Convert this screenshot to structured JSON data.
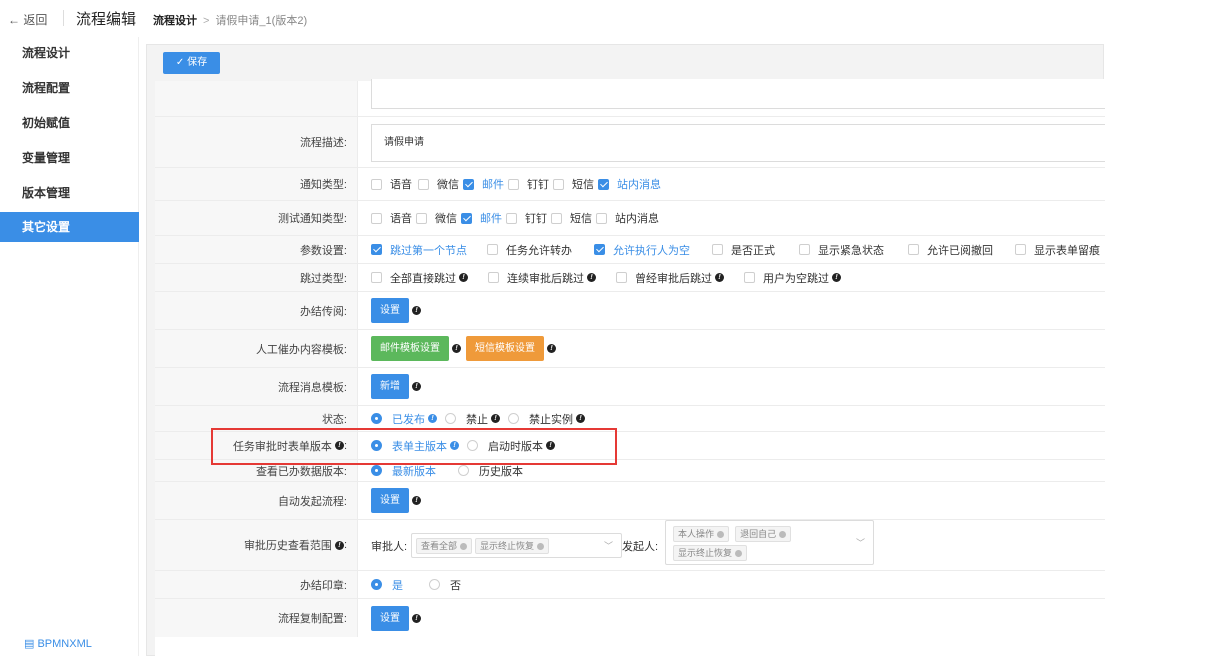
{
  "header": {
    "back": "← 返回",
    "title": "流程编辑",
    "breadcrumb_current": "流程设计",
    "breadcrumb_sep": ">",
    "breadcrumb_doc": "请假申请_1(版本2)"
  },
  "sidebar": {
    "items": [
      "流程设计",
      "流程配置",
      "初始赋值",
      "变量管理",
      "版本管理",
      "其它设置"
    ],
    "active": "其它设置",
    "footer": "BPMNXML"
  },
  "toolbar": {
    "save": "✓ 保存"
  },
  "form": {
    "desc_label": "流程描述:",
    "desc_value": "请假申请",
    "notify_label": "通知类型:",
    "notify_options": [
      {
        "label": "语音",
        "checked": false
      },
      {
        "label": "微信",
        "checked": true
      },
      {
        "label": "邮件",
        "checked": false
      },
      {
        "label": "钉钉",
        "checked": false
      },
      {
        "label": "短信",
        "checked": true
      },
      {
        "label": "站内消息",
        "checked": false
      }
    ],
    "test_notify_label": "测试通知类型:",
    "test_notify_options": [
      {
        "label": "语音",
        "checked": false
      },
      {
        "label": "微信",
        "checked": true
      },
      {
        "label": "邮件",
        "checked": false
      },
      {
        "label": "钉钉",
        "checked": false
      },
      {
        "label": "短信",
        "checked": false
      },
      {
        "label": "站内消息",
        "checked": false
      }
    ],
    "param_label": "参数设置:",
    "param_options": [
      {
        "label": "跳过第一个节点",
        "checked": true
      },
      {
        "label": "任务允许转办",
        "checked": false
      },
      {
        "label": "允许执行人为空",
        "checked": true
      },
      {
        "label": "是否正式",
        "checked": false
      },
      {
        "label": "显示紧急状态",
        "checked": false
      },
      {
        "label": "允许已阅撤回",
        "checked": false
      },
      {
        "label": "显示表单留痕",
        "checked": false
      }
    ],
    "skip_label": "跳过类型:",
    "skip_options": [
      "全部直接跳过",
      "连续审批后跳过",
      "曾经审批后跳过",
      "用户为空跳过"
    ],
    "circulate_label": "办结传阅:",
    "set_btn": "设置",
    "remind_label": "人工催办内容模板:",
    "email_tpl_btn": "邮件模板设置",
    "sms_tpl_btn": "短信模板设置",
    "msg_tpl_label": "流程消息模板:",
    "add_btn": "新增",
    "status_label": "状态:",
    "status_options": [
      {
        "label": "已发布",
        "checked": true
      },
      {
        "label": "禁止",
        "checked": false
      },
      {
        "label": "禁止实例",
        "checked": false
      }
    ],
    "form_ver_label": "任务审批时表单版本",
    "form_ver_options": [
      {
        "label": "表单主版本",
        "checked": true
      },
      {
        "label": "启动时版本",
        "checked": false
      }
    ],
    "view_ver_label": "查看已办数据版本:",
    "view_ver_options": [
      {
        "label": "最新版本",
        "checked": true
      },
      {
        "label": "历史版本",
        "checked": false
      }
    ],
    "auto_label": "自动发起流程:",
    "history_label": "审批历史查看范围",
    "approver_label": "审批人:",
    "approver_tags": [
      "查看全部",
      "显示终止恢复"
    ],
    "initiator_label": "发起人:",
    "initiator_tags": [
      "本人操作",
      "退回自己",
      "显示终止恢复"
    ],
    "seal_label": "办结印章:",
    "seal_options": [
      {
        "label": "是",
        "checked": true
      },
      {
        "label": "否",
        "checked": false
      }
    ],
    "copy_label": "流程复制配置:"
  }
}
